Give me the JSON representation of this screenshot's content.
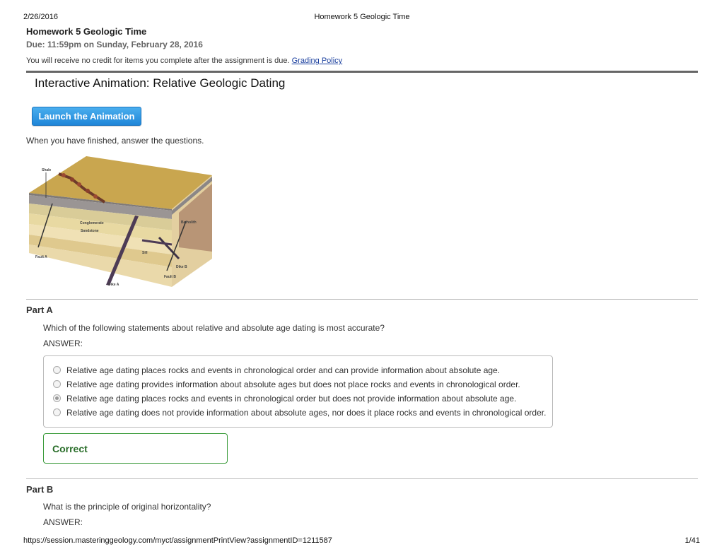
{
  "print_header": {
    "date": "2/26/2016",
    "title": "Homework 5 Geologic Time"
  },
  "assignment": {
    "title": "Homework 5 Geologic Time",
    "due": "Due: 11:59pm on Sunday, February 28, 2016",
    "credit_notice": "You will receive no credit for items you complete after the assignment is due.",
    "grading_policy_link": "Grading Policy"
  },
  "section": {
    "title": "Interactive Animation: Relative Geologic Dating",
    "launch_button": "Launch the Animation",
    "instruction": "When you have finished, answer the questions."
  },
  "figure": {
    "labels": {
      "shale": "Shale",
      "conglomerate": "Conglomerate",
      "sandstone": "Sandstone",
      "batholith": "Batholith",
      "sill": "Sill",
      "fault_a": "Fault A",
      "fault_b": "Fault B",
      "dike_a": "Dike A",
      "dike_b": "Dike B"
    },
    "colors": {
      "top": "#c9a64f",
      "batholith": "#b89576",
      "dike": "#4d3b55"
    }
  },
  "part_a": {
    "label": "Part A",
    "question": "Which of the following statements about relative and absolute age dating is most accurate?",
    "answer_label": "ANSWER:",
    "choices": [
      {
        "text": "Relative age dating places rocks and events in chronological order and can provide information about absolute age.",
        "selected": false
      },
      {
        "text": "Relative age dating provides information about absolute ages but does not place rocks and events in chronological order.",
        "selected": false
      },
      {
        "text": "Relative age dating places rocks and events in chronological order but does not provide information about absolute age.",
        "selected": true
      },
      {
        "text": "Relative age dating does not provide information about absolute ages, nor does it place rocks and events in chronological order.",
        "selected": false
      }
    ],
    "feedback": "Correct",
    "feedback_color": "#2a6e2a"
  },
  "part_b": {
    "label": "Part B",
    "question": "What is the principle of original horizontality?",
    "answer_label": "ANSWER:"
  },
  "print_footer": {
    "url": "https://session.masteringgeology.com/myct/assignmentPrintView?assignmentID=1211587",
    "page": "1/41"
  }
}
